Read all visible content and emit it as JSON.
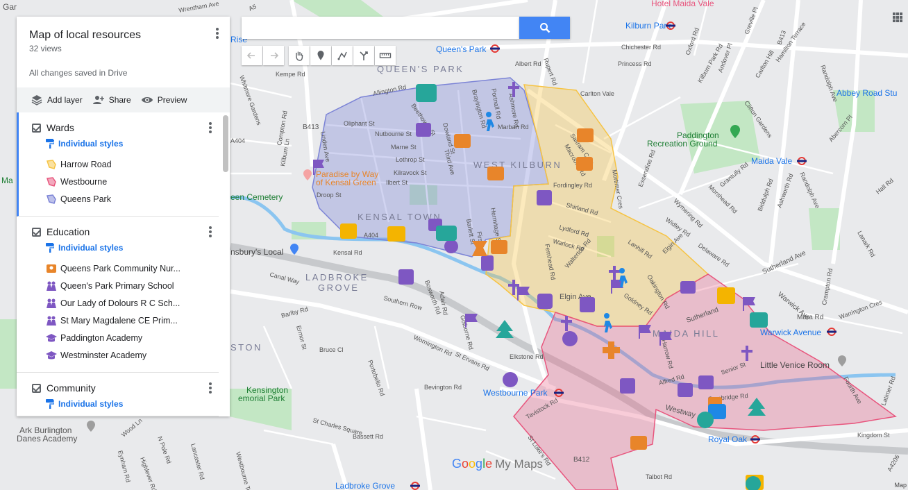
{
  "panel": {
    "title": "Map of local resources",
    "views": "32 views",
    "saved": "All changes saved in Drive",
    "toolbar": {
      "add_layer": "Add layer",
      "share": "Share",
      "preview": "Preview"
    },
    "layers": [
      {
        "name": "Wards",
        "styles": "Individual styles",
        "items": [
          {
            "label": "Harrow Road",
            "icon": "polygon-icon",
            "color": "#f6c342"
          },
          {
            "label": "Westbourne",
            "icon": "polygon-icon",
            "color": "#e8557d"
          },
          {
            "label": "Queens Park",
            "icon": "polygon-icon",
            "color": "#7b83d6"
          }
        ]
      },
      {
        "name": "Education",
        "styles": "Individual styles",
        "items": [
          {
            "label": "Queens Park Community Nur...",
            "icon": "nursery-icon",
            "color": "#e8852a"
          },
          {
            "label": "Queen's Park Primary School",
            "icon": "children-icon",
            "color": "#7e57c2"
          },
          {
            "label": "Our Lady of Dolours R C Sch...",
            "icon": "children-icon",
            "color": "#7e57c2"
          },
          {
            "label": "St Mary Magdalene CE Prim...",
            "icon": "children-icon",
            "color": "#7e57c2"
          },
          {
            "label": "Paddington Academy",
            "icon": "graduation-cap-icon",
            "color": "#7e57c2"
          },
          {
            "label": "Westminster Academy",
            "icon": "graduation-cap-icon",
            "color": "#7e57c2"
          }
        ]
      },
      {
        "name": "Community",
        "styles": "Individual styles",
        "items": []
      }
    ]
  },
  "search": {
    "placeholder": ""
  },
  "logo": {
    "google": [
      "G",
      "o",
      "o",
      "g",
      "l",
      "e"
    ],
    "product": "My Maps"
  },
  "attribution": "Map",
  "map_labels": {
    "areas": [
      "QUEEN'S PARK",
      "WEST KILBURN",
      "KENSAL TOWN",
      "LADBROKE",
      "GROVE",
      "MAIDA HILL",
      "STON"
    ],
    "places": [
      "Queen's Park",
      "Kilburn Park",
      "Hotel Maida Vale",
      "Abbey Road Stu",
      "Paddington",
      "Recreation Ground",
      "Maida Vale",
      "Paradise by Way",
      "of Kensal Green",
      "een Cemetery",
      "nsbury's Local",
      "Warwick Avenue",
      "Little Venice Room",
      "Westbourne Park",
      "Royal Oak",
      "Kensington",
      "emorial Park",
      "Ladbroke Grove",
      "Ark Burlington",
      "Danes Academy",
      "Rise",
      "Ma",
      "Gar"
    ],
    "roads": [
      "Chichester Rd",
      "Princess Rd",
      "Carlton Vale",
      "Albert Rd",
      "Rupert Rd",
      "Allington Rd",
      "Kempe Rd",
      "Oliphant St",
      "Nutbourne St",
      "Marne St",
      "Lothrop St",
      "Kilravock St",
      "Ilbert St",
      "Droop St",
      "Beethoven St",
      "Brayington Rd",
      "Portnall Rd",
      "Ashmore Rd",
      "Marban Rd",
      "Dowland St",
      "Third Ave",
      "Barlett St",
      "First Ave",
      "Fernhead Rd",
      "Saltram Cres",
      "Macroom Rd",
      "Fordingley Rd",
      "Shirland Rd",
      "Lydford Rd",
      "Warlock Rd",
      "Walterton Rd",
      "Elgin Ave",
      "Lanhill Rd",
      "Oakington Rd",
      "Goldney Rd",
      "Kensal Rd",
      "A404",
      "Canal Way",
      "Southern Row",
      "Adair Rd",
      "Bosworth Rd",
      "Golborne Rd",
      "Portobello Rd",
      "Barlby Rd",
      "Ermor St",
      "Bruce Cl",
      "Wornington Rd",
      "Elkstone Rd",
      "St Ervans Rd",
      "Bevington Rd",
      "St Charles Square",
      "Bassett Rd",
      "Tavistock Rd",
      "St Luke's Rd",
      "B412",
      "Talbot Rd",
      "Westway",
      "Harrow Rd",
      "Alfred Rd",
      "Senior St",
      "Sutherland",
      "Sutherland Ave",
      "Warwick Ave",
      "Kingdom St",
      "A4206",
      "Elgin Ave",
      "Delaware Rd",
      "Widley Rd",
      "Wymering Rd",
      "Morshead Rd",
      "Randolph Ave",
      "Essendine Rd",
      "Oxford Rd",
      "Kilburn Park Rd",
      "Andover Pl",
      "Mortimer Cres",
      "Hall Rd",
      "Abercorn Pl",
      "Grantully Rd",
      "Biddulph Rd",
      "Ashworth Rd",
      "Lanark Rd",
      "Carlton Hill",
      "Hamilton Terrace",
      "Randolph Ave",
      "Clifton Gardens",
      "Warrington Cres",
      "Crampton Rd",
      "Compton Rd",
      "Kilburn Ln",
      "Linden Ave",
      "Whitmore Gardens",
      "Wrentham Ave",
      "A5",
      "Greville Pl",
      "B413",
      "B413",
      "Mara Rd",
      "A404",
      "Latimer Rd",
      "N Pole Rd",
      "Wood Ln",
      "Eynham Rd",
      "Highlever Rd",
      "Lancaster Rd",
      "Westbourne Terrace",
      "Cambridge Rd",
      "Fourth Ave",
      "Hermitage St"
    ]
  },
  "colors": {
    "queens_park_fill": "#7b83d6",
    "harrow_road_fill": "#f6c342",
    "westbourne_fill": "#e8557d",
    "education_icon": "#7e57c2",
    "nursery_icon": "#e8852a",
    "community_icon": "#26a69a",
    "search_button": "#4285f4"
  }
}
